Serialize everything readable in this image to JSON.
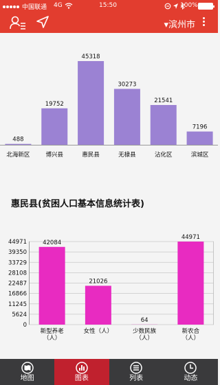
{
  "status_bar": {
    "carrier": "中国联通",
    "network": "4G",
    "time": "15:50",
    "battery": "100%",
    "battery_level": 1.0
  },
  "nav": {
    "city": "滨州市",
    "city_indicator": "▾"
  },
  "colors": {
    "brand_red": "#e23d2f",
    "tab_active": "#c0212e",
    "tabbar_bg": "#3a3a3c",
    "bar_purple": "#9b82d3",
    "bar_magenta": "#e82bc1"
  },
  "chart_data": [
    {
      "type": "bar",
      "title": "",
      "categories": [
        "北海新区",
        "博兴县",
        "惠民县",
        "无棣县",
        "沾化区",
        "滨城区"
      ],
      "values": [
        488,
        19752,
        45318,
        30273,
        21541,
        7196
      ],
      "value_labels": [
        "488",
        "19752",
        "45318",
        "30273",
        "21541",
        "7196"
      ],
      "ylim": [
        0,
        45318
      ],
      "color": "#9b82d3",
      "grid": false
    },
    {
      "type": "bar",
      "title": "惠民县(贫困人口基本信息统计表)",
      "categories": [
        [
          "新型养老",
          "（人）"
        ],
        [
          "女性（人）"
        ],
        [
          "少数民族",
          "（人）"
        ],
        [
          "新农合",
          "（人）"
        ]
      ],
      "values": [
        42084,
        21026,
        64,
        44971
      ],
      "value_labels": [
        "42084",
        "21026",
        "64",
        "44971"
      ],
      "yticks": [
        "0",
        "5624",
        "11245",
        "16866",
        "22487",
        "28108",
        "33729",
        "39350",
        "44971"
      ],
      "ylim": [
        0,
        44971
      ],
      "color": "#e82bc1",
      "grid": true
    }
  ],
  "tabs": [
    {
      "label": "地图",
      "icon": "map-icon",
      "active": false
    },
    {
      "label": "图表",
      "icon": "bar-chart-icon",
      "active": true
    },
    {
      "label": "列表",
      "icon": "list-icon",
      "active": false
    },
    {
      "label": "动态",
      "icon": "clock-icon",
      "active": false
    }
  ]
}
